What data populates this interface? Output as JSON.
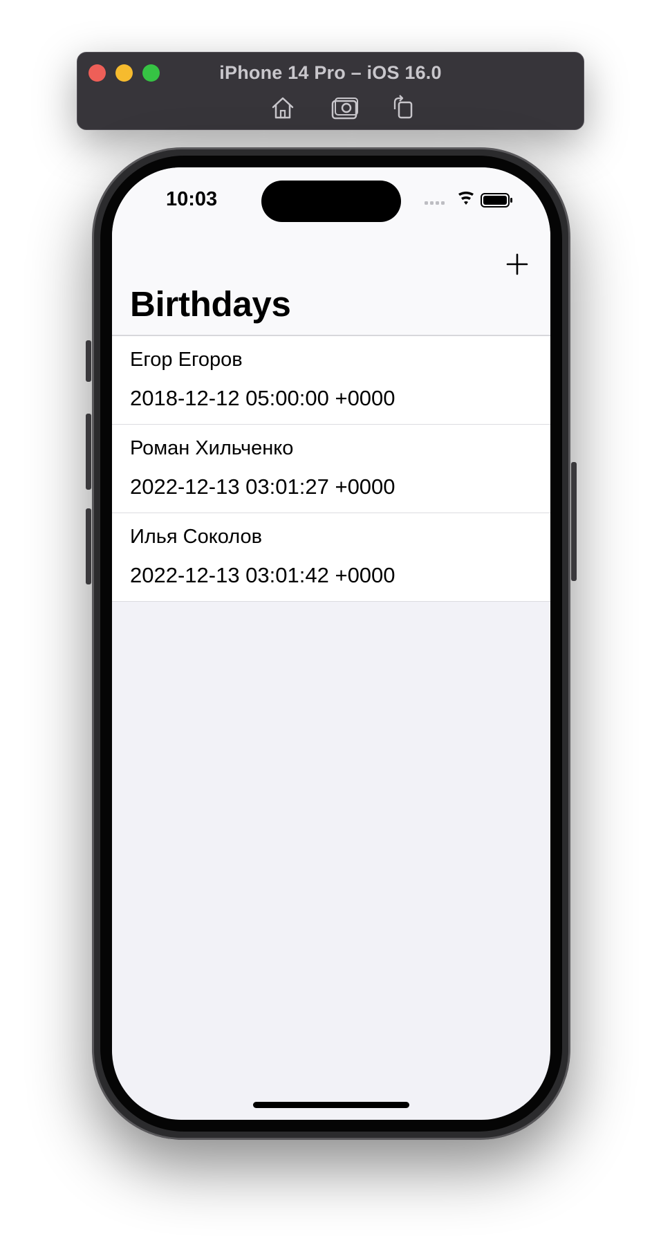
{
  "simulator": {
    "title": "iPhone 14 Pro – iOS 16.0",
    "tools": [
      "home-icon",
      "screenshot-icon",
      "rotate-icon"
    ]
  },
  "status_bar": {
    "time": "10:03"
  },
  "navbar": {
    "title": "Birthdays",
    "add_icon": "plus-icon"
  },
  "birthdays": [
    {
      "name": "Егор Егоров",
      "date": "2018-12-12 05:00:00 +0000"
    },
    {
      "name": "Роман Хильченко",
      "date": "2022-12-13 03:01:27 +0000"
    },
    {
      "name": "Илья  Соколов",
      "date": "2022-12-13 03:01:42 +0000"
    }
  ],
  "colors": {
    "close": "#ee5f58",
    "minimize": "#f6bb2e",
    "maximize": "#36c344",
    "background": "#f2f2f7"
  }
}
